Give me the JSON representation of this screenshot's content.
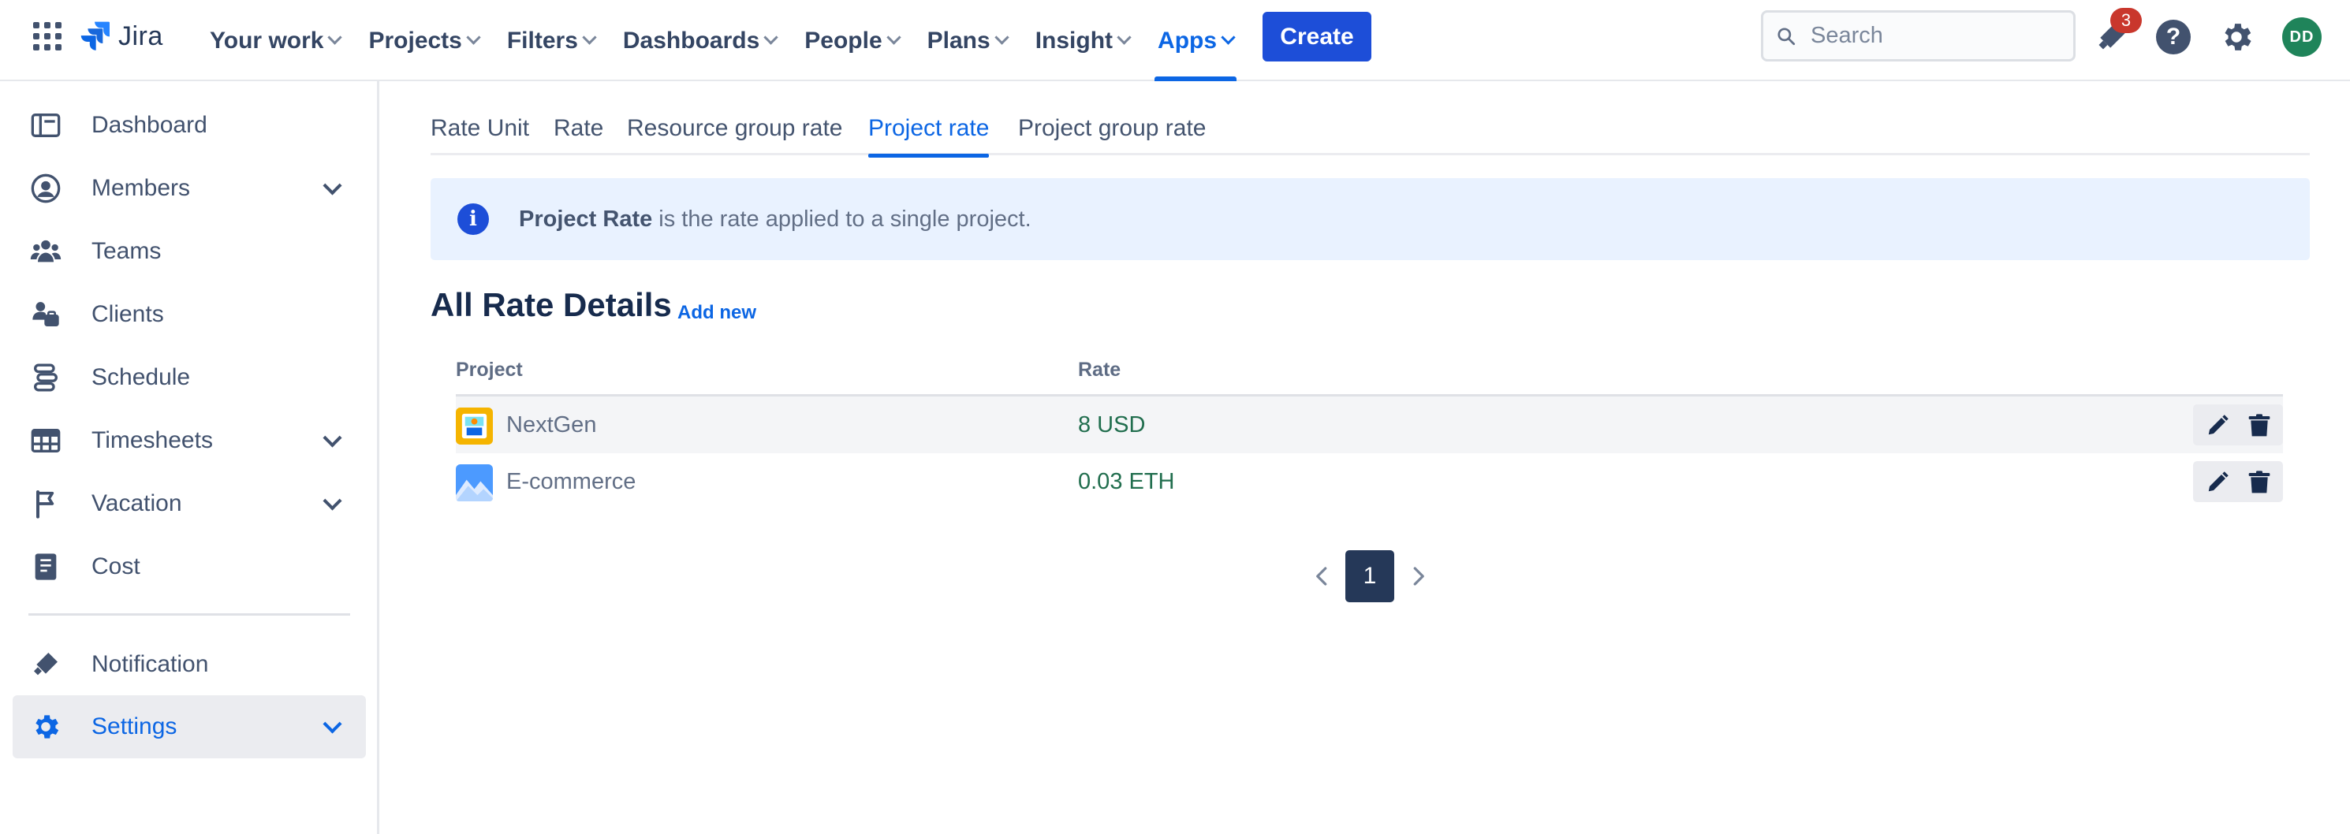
{
  "brand": {
    "name": "Jira",
    "color": "#0c66e4"
  },
  "topnav": {
    "items": [
      {
        "label": "Your work",
        "active": false
      },
      {
        "label": "Projects",
        "active": false
      },
      {
        "label": "Filters",
        "active": false
      },
      {
        "label": "Dashboards",
        "active": false
      },
      {
        "label": "People",
        "active": false
      },
      {
        "label": "Plans",
        "active": false
      },
      {
        "label": "Insight",
        "active": false
      },
      {
        "label": "Apps",
        "active": true
      }
    ],
    "create_label": "Create",
    "search_placeholder": "Search",
    "notification_count": "3",
    "help_glyph": "?",
    "avatar_initials": "DD"
  },
  "sidebar": {
    "items": [
      {
        "label": "Dashboard",
        "icon": "dashboard-icon",
        "has_chevron": false,
        "active": false
      },
      {
        "label": "Members",
        "icon": "person-icon",
        "has_chevron": true,
        "active": false
      },
      {
        "label": "Teams",
        "icon": "people-group-icon",
        "has_chevron": false,
        "active": false
      },
      {
        "label": "Clients",
        "icon": "clients-icon",
        "has_chevron": false,
        "active": false
      },
      {
        "label": "Schedule",
        "icon": "schedule-icon",
        "has_chevron": false,
        "active": false
      },
      {
        "label": "Timesheets",
        "icon": "table-icon",
        "has_chevron": true,
        "active": false
      },
      {
        "label": "Vacation",
        "icon": "flag-icon",
        "has_chevron": true,
        "active": false
      },
      {
        "label": "Cost",
        "icon": "receipt-icon",
        "has_chevron": false,
        "active": false
      },
      {
        "label": "Notification",
        "icon": "megaphone-icon",
        "has_chevron": false,
        "active": false
      },
      {
        "label": "Settings",
        "icon": "gear-icon",
        "has_chevron": true,
        "active": true
      }
    ]
  },
  "tabs": [
    {
      "label": "Rate Unit",
      "active": false
    },
    {
      "label": "Rate",
      "active": false
    },
    {
      "label": "Resource group rate",
      "active": false
    },
    {
      "label": "Project rate",
      "active": true
    },
    {
      "label": "Project group rate",
      "active": false
    }
  ],
  "banner": {
    "bold": "Project Rate",
    "text": " is the rate applied to a single project.",
    "icon_glyph": "i"
  },
  "section": {
    "title": "All Rate Details",
    "add_new": "Add new"
  },
  "table": {
    "columns": [
      "Project",
      "Rate"
    ],
    "rows": [
      {
        "project": "NextGen",
        "rate": "8 USD",
        "icon": "nextgen-project-icon"
      },
      {
        "project": "E-commerce",
        "rate": "0.03 ETH",
        "icon": "ecommerce-project-icon"
      }
    ]
  },
  "pagination": {
    "current": "1"
  },
  "colors": {
    "accent": "#0c66e4",
    "create_button": "#1d4ed8",
    "rate_text": "#216e4e",
    "banner_bg": "#e9f2ff",
    "page_active": "#253858",
    "badge": "#c9372c",
    "avatar": "#1f845a"
  }
}
